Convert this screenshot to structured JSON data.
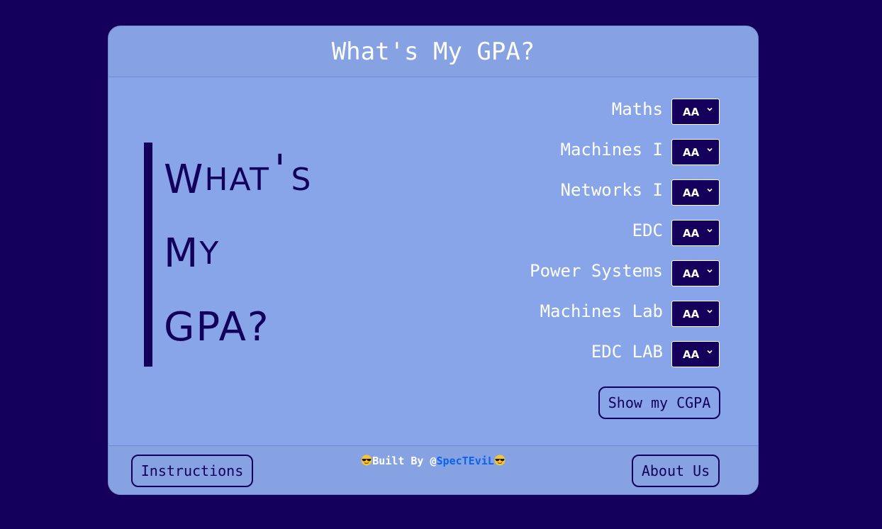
{
  "header": {
    "title": "What's My GPA?"
  },
  "hero": {
    "line1_big": "W",
    "line1_small": "HAT",
    "line1_apos": "'",
    "line1_tail": "S",
    "line2_big": "M",
    "line2_small": "Y",
    "line3_big": "GPA?"
  },
  "subjects": [
    {
      "label": "Maths",
      "grade": "AA"
    },
    {
      "label": "Machines I",
      "grade": "AA"
    },
    {
      "label": "Networks I",
      "grade": "AA"
    },
    {
      "label": "EDC",
      "grade": "AA"
    },
    {
      "label": "Power Systems",
      "grade": "AA"
    },
    {
      "label": "Machines Lab",
      "grade": "AA"
    },
    {
      "label": "EDC LAB",
      "grade": "AA"
    }
  ],
  "actions": {
    "show_cgpa": "Show my CGPA"
  },
  "footer": {
    "instructions": "Instructions",
    "about": "About Us",
    "credit_prefix": "Built By @",
    "credit_link": "SpecTEviL"
  },
  "colors": {
    "page_bg": "#14005a",
    "card_bg": "#87a5e8",
    "dark_navy": "#14005a",
    "link_blue": "#0a63e8"
  },
  "icons": {
    "select_arrow": "chevron-down-icon",
    "credit_emoji": "sunglasses-emoji-icon"
  }
}
